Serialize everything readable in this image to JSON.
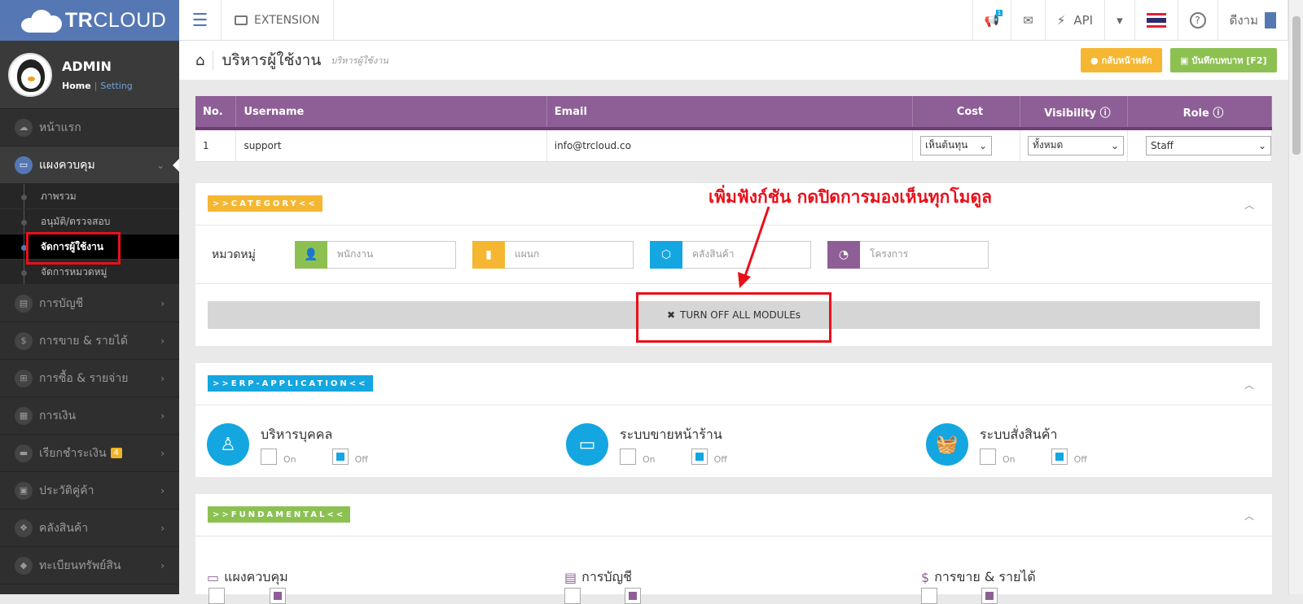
{
  "brand": {
    "logo_bold": "TR",
    "logo_rest": "CLOUD"
  },
  "profile": {
    "name": "ADMIN",
    "home_link": "Home",
    "separator": "|",
    "setting_link": "Setting"
  },
  "sidebar": {
    "items": [
      {
        "label": "หน้าแรก",
        "icon": "cloud-icon"
      },
      {
        "label": "แผงควบคุม",
        "icon": "monitor-icon"
      },
      {
        "label": "การบัญชี",
        "icon": "book-icon"
      },
      {
        "label": "การขาย & รายได้",
        "icon": "dollar-icon"
      },
      {
        "label": "การซื้อ & รายจ่าย",
        "icon": "cart-icon"
      },
      {
        "label": "การเงิน",
        "icon": "calendar-icon"
      },
      {
        "label": "เรียกชำระเงิน",
        "icon": "card-icon",
        "badge": "4"
      },
      {
        "label": "ประวัติคู่ค้า",
        "icon": "contact-icon"
      },
      {
        "label": "คลังสินค้า",
        "icon": "cubes-icon"
      },
      {
        "label": "ทะเบียนทรัพย์สิน",
        "icon": "diamond-icon"
      }
    ],
    "sub_items": [
      "ภาพรวม",
      "อนุมัติ/ตรวจสอบ",
      "จัดการผู้ใช้งาน",
      "จัดการหมวดหมู่"
    ]
  },
  "topbar": {
    "extension_label": "EXTENSION",
    "notif_count": "1",
    "api_label": "API",
    "user_label": "ดีงาม"
  },
  "header": {
    "title": "บริหารผู้ใช้งาน",
    "subtitle": "บริหารผู้ใช้งาน",
    "back_button": "กลับหน้าหลัก",
    "save_button": "บันทึกบทบาท [F2]"
  },
  "users_table": {
    "columns": [
      "No.",
      "Username",
      "Email",
      "Cost",
      "Visibility",
      "Role"
    ],
    "rows": [
      {
        "no": "1",
        "username": "support",
        "email": "info@trcloud.co",
        "cost": "เห็นต้นทุน",
        "visibility": "ทั้งหมด",
        "role": "Staff"
      }
    ]
  },
  "category": {
    "tag": ">>CATEGORY<<",
    "label": "หมวดหมู่",
    "inputs": [
      {
        "placeholder": "พนักงาน",
        "icon": "user-icon",
        "color": "#8cc152"
      },
      {
        "placeholder": "แผนก",
        "icon": "building-icon",
        "color": "#f5b731"
      },
      {
        "placeholder": "คลังสินค้า",
        "icon": "cube-icon",
        "color": "#14a6e0"
      },
      {
        "placeholder": "โครงการ",
        "icon": "pie-chart-icon",
        "color": "#8e5f96"
      }
    ],
    "turn_off_button": "TURN OFF ALL MODULEs"
  },
  "annotation": "เพิ่มฟังก์ชัน กดปิดการมองเห็นทุกโมดูล",
  "erp": {
    "tag": ">>ERP-APPLICATION<<",
    "modules": [
      {
        "name": "บริหารบุคคล",
        "icon": "person-icon"
      },
      {
        "name": "ระบบขายหน้าร้าน",
        "icon": "monitor-icon"
      },
      {
        "name": "ระบบสั่งสินค้า",
        "icon": "basket-icon"
      }
    ],
    "on_label": "On",
    "off_label": "Off"
  },
  "fundamental": {
    "tag": ">>FUNDAMENTAL<<",
    "modules": [
      {
        "name": "แผงควบคุม",
        "icon": "monitor-icon"
      },
      {
        "name": "การบัญชี",
        "icon": "book-icon"
      },
      {
        "name": "การขาย & รายได้",
        "icon": "dollar-icon"
      }
    ]
  },
  "colors": {
    "brand": "#5578b4",
    "table_header": "#8e5f96",
    "category_tag": "#f5b731",
    "erp_tag": "#14a6e0",
    "fund_tag": "#8cc152",
    "annotation": "#e8101a"
  }
}
